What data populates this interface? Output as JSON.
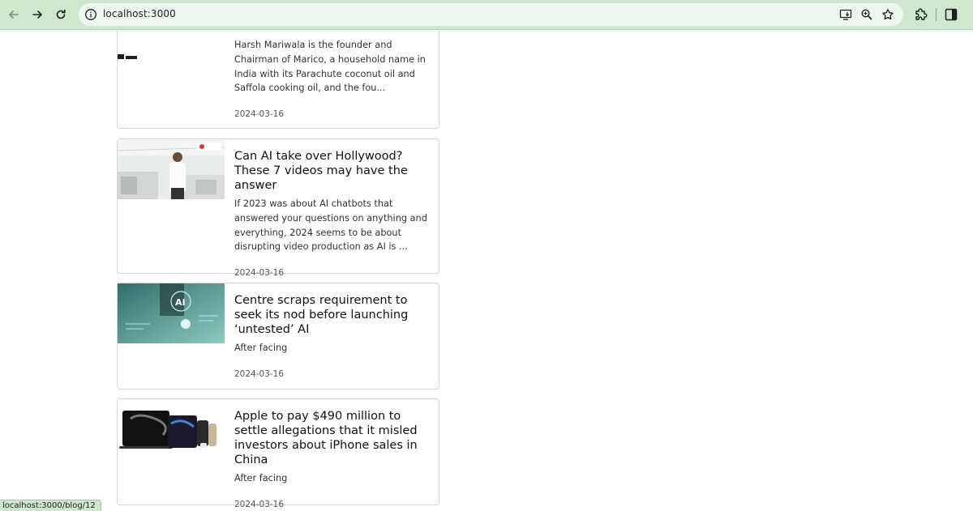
{
  "browser": {
    "url": "localhost:3000",
    "status_url": "localhost:3000/blog/12",
    "icons": {
      "back": "arrow-left-icon",
      "forward": "arrow-right-icon",
      "reload": "reload-icon",
      "info": "info-icon",
      "install": "install-app-icon",
      "zoom": "zoom-icon",
      "bookmark": "star-icon",
      "extensions": "puzzle-icon",
      "side_panel": "side-panel-icon"
    },
    "accent": "#cfe7cf"
  },
  "posts": [
    {
      "excerpt": "Harsh Mariwala is the founder and Chairman of Marico, a household name in India with its Parachute coconut oil and Saffola cooking oil, and the fou...",
      "date": "2024-03-16"
    },
    {
      "title": "Can AI take over Hollywood? These 7 videos may have the answer",
      "excerpt": "If 2023 was about AI chatbots that answered your questions on anything and everything, 2024 seems to be about disrupting video production as AI is ...",
      "date": "2024-03-16"
    },
    {
      "title": "Centre scraps requirement to seek its nod before launching ‘untested’ AI",
      "excerpt": "After facing",
      "date": "2024-03-16",
      "image_text": "AI"
    },
    {
      "title": "Apple to pay $490 million to settle allegations that it misled investors about iPhone sales in China",
      "excerpt": "After facing",
      "date": "2024-03-16"
    }
  ]
}
